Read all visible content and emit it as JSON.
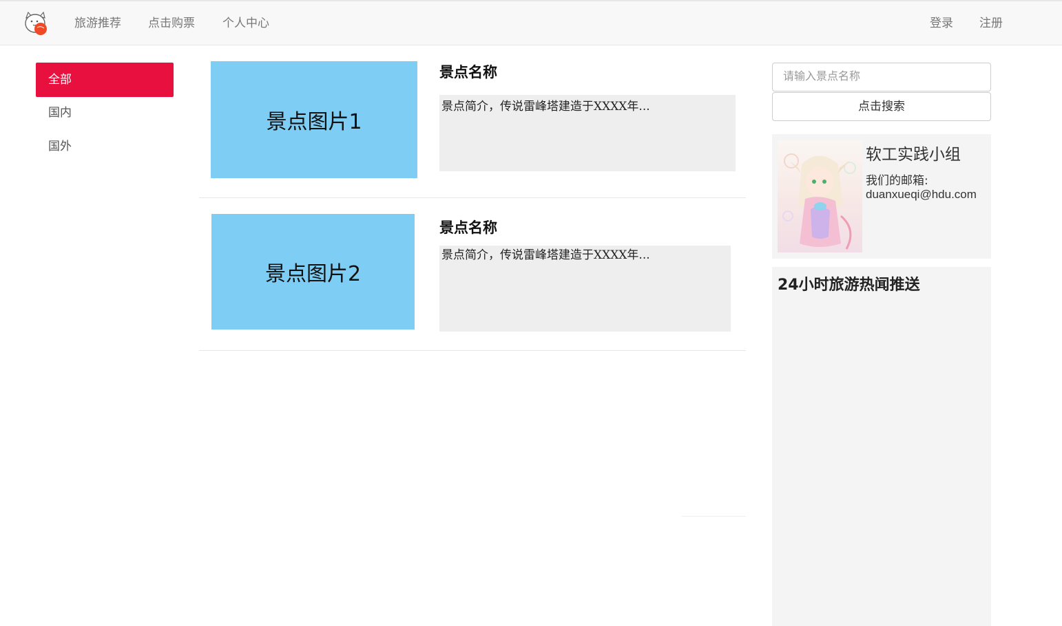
{
  "nav": {
    "logo_icon": "cat-logo-icon",
    "links": [
      "旅游推荐",
      "点击购票",
      "个人中心"
    ],
    "login": "登录",
    "register": "注册"
  },
  "sidebar": {
    "items": [
      {
        "label": "全部",
        "active": true
      },
      {
        "label": "国内",
        "active": false
      },
      {
        "label": "国外",
        "active": false
      }
    ],
    "active_color": "#e8103f"
  },
  "cards": [
    {
      "image_label": "景点图片1",
      "title": "景点名称",
      "description": "景点简介，传说雷峰塔建造于XXXX年..."
    },
    {
      "image_label": "景点图片2",
      "title": "景点名称",
      "description": "景点简介，传说雷峰塔建造于XXXX年..."
    }
  ],
  "search": {
    "placeholder": "请输入景点名称",
    "button_label": "点击搜索"
  },
  "profile": {
    "name": "软工实践小组",
    "email_label": "我们的邮箱:",
    "email": "duanxueqi@hdu.com"
  },
  "hot_news": {
    "title": "24小时旅游热闻推送"
  },
  "colors": {
    "image_placeholder": "#7ecdf4",
    "desc_bg": "#eeeeee",
    "panel_bg": "#f4f4f4"
  }
}
